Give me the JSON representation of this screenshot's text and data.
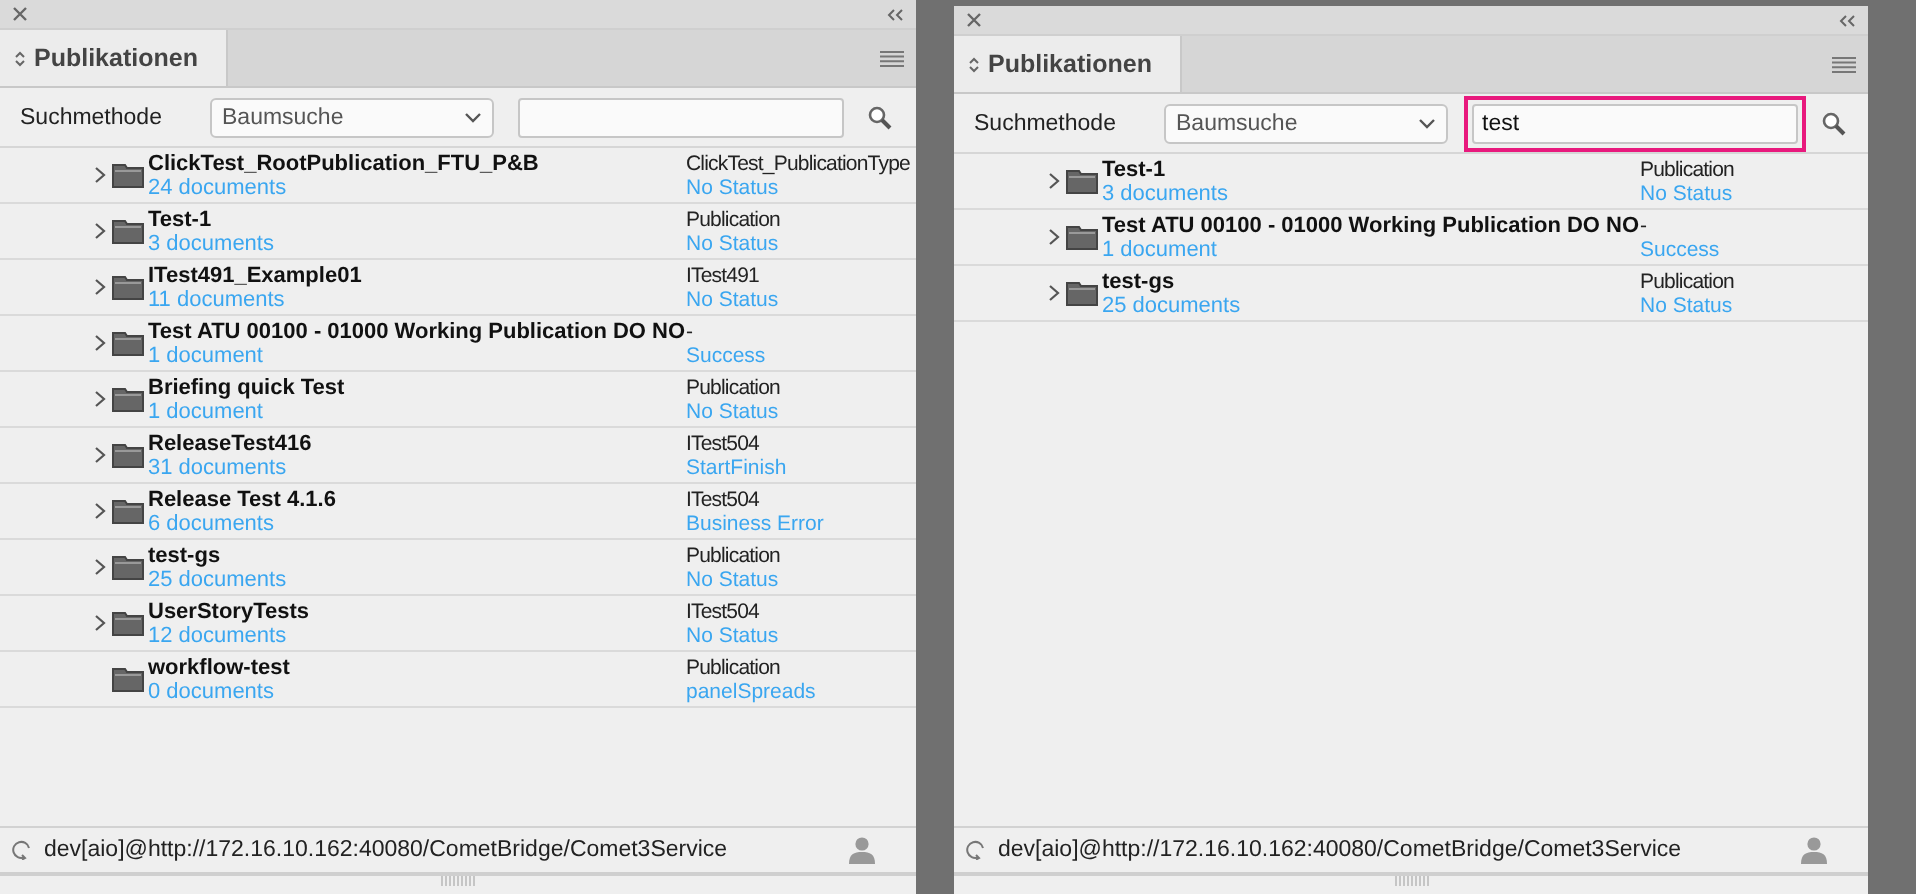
{
  "panels": [
    {
      "title": "Publikationen",
      "search_method_label": "Suchmethode",
      "search_method": "Baumsuche",
      "search": {
        "highlighted": false
      },
      "rows": [
        {
          "name": "ClickTest_RootPublication_FTU_P&B",
          "count": "24 documents",
          "type": "ClickTest_PublicationType",
          "status": "No Status",
          "expandable": true
        },
        {
          "name": "Test-1",
          "count": "3 documents",
          "type": "Publication",
          "status": "No Status",
          "expandable": true
        },
        {
          "name": "ITest491_Example01",
          "count": "11 documents",
          "type": "ITest491",
          "status": "No Status",
          "expandable": true
        },
        {
          "name": "Test ATU 00100 - 01000 Working Publication DO NO",
          "count": "1 document",
          "type": "-",
          "status": "Success",
          "expandable": true
        },
        {
          "name": "Briefing quick Test",
          "count": "1 document",
          "type": "Publication",
          "status": "No Status",
          "expandable": true
        },
        {
          "name": "ReleaseTest416",
          "count": "31 documents",
          "type": "ITest504",
          "status": "StartFinish",
          "expandable": true
        },
        {
          "name": "Release Test 4.1.6",
          "count": "6 documents",
          "type": "ITest504",
          "status": "Business Error",
          "expandable": true
        },
        {
          "name": "test-gs",
          "count": "25 documents",
          "type": "Publication",
          "status": "No Status",
          "expandable": true
        },
        {
          "name": "UserStoryTests",
          "count": "12 documents",
          "type": "ITest504",
          "status": "No Status",
          "expandable": true
        },
        {
          "name": "workflow-test",
          "count": "0 documents",
          "type": "Publication",
          "status": "panelSpreads",
          "expandable": false
        }
      ],
      "status_bar": "dev[aio]@http://172.16.10.162:40080/CometBridge/Comet3Service"
    },
    {
      "title": "Publikationen",
      "search_method_label": "Suchmethode",
      "search_method": "Baumsuche",
      "search": {
        "value": "test",
        "highlighted": true
      },
      "rows": [
        {
          "name": "Test-1",
          "count": "3 documents",
          "type": "Publication",
          "status": "No Status",
          "expandable": true
        },
        {
          "name": "Test ATU 00100 - 01000 Working Publication DO NO",
          "count": "1 document",
          "type": "-",
          "status": "Success",
          "expandable": true
        },
        {
          "name": "test-gs",
          "count": "25 documents",
          "type": "Publication",
          "status": "No Status",
          "expandable": true
        }
      ],
      "status_bar": "dev[aio]@http://172.16.10.162:40080/CometBridge/Comet3Service"
    }
  ]
}
